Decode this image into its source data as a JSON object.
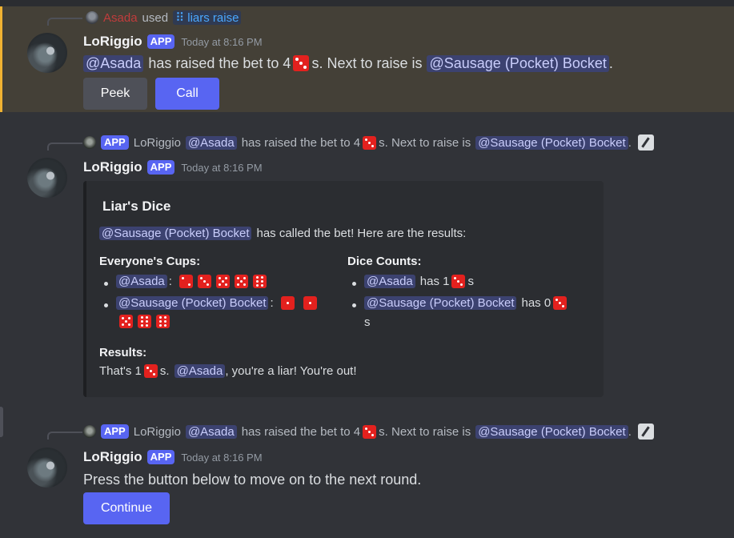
{
  "messages": [
    {
      "reply": {
        "user": "Asada",
        "used": "used",
        "command": "liars raise"
      },
      "author": "LoRiggio",
      "tag": "APP",
      "time": "Today at 8:16 PM",
      "text": {
        "mention1": "@Asada",
        "part1": "has raised the bet to 4",
        "part2": "s. Next to raise is",
        "mention2": "@Sausage (Pocket) Bocket",
        "end": "."
      },
      "buttons": [
        "Peek",
        "Call"
      ]
    },
    {
      "reply": {
        "tag": "APP",
        "author": "LoRiggio",
        "mention1": "@Asada",
        "part1": "has raised the bet to 4",
        "part2": "s. Next to raise is",
        "mention2": "@Sausage (Pocket) Bocket",
        "end": "."
      },
      "author": "LoRiggio",
      "tag": "APP",
      "time": "Today at 8:16 PM",
      "embed": {
        "title": "Liar's Dice",
        "desc_mention": "@Sausage (Pocket) Bocket",
        "desc": "has called the bet! Here are the results:",
        "cups_title": "Everyone's Cups:",
        "counts_title": "Dice Counts:",
        "cups": [
          {
            "mention": "@Asada",
            "sep": ":"
          },
          {
            "mention": "@Sausage (Pocket) Bocket",
            "sep": ":"
          }
        ],
        "counts": [
          {
            "mention": "@Asada",
            "pre": "has 1",
            "post": "s"
          },
          {
            "mention": "@Sausage (Pocket) Bocket",
            "pre": "has 0",
            "post": "s"
          }
        ],
        "results_title": "Results:",
        "results": {
          "pre": "That's 1",
          "mid": "s.",
          "mention": "@Asada",
          "post": ", you're a liar! You're out!"
        }
      }
    },
    {
      "reply": {
        "tag": "APP",
        "author": "LoRiggio",
        "mention1": "@Asada",
        "part1": "has raised the bet to 4",
        "part2": "s. Next to raise is",
        "mention2": "@Sausage (Pocket) Bocket",
        "end": "."
      },
      "author": "LoRiggio",
      "tag": "APP",
      "time": "Today at 8:16 PM",
      "text": "Press the button below to move on to the next round.",
      "buttons": [
        "Continue"
      ]
    }
  ],
  "colors": {
    "die": "#e3211e",
    "blurple": "#5865f2",
    "highlight": "#f0b232"
  }
}
